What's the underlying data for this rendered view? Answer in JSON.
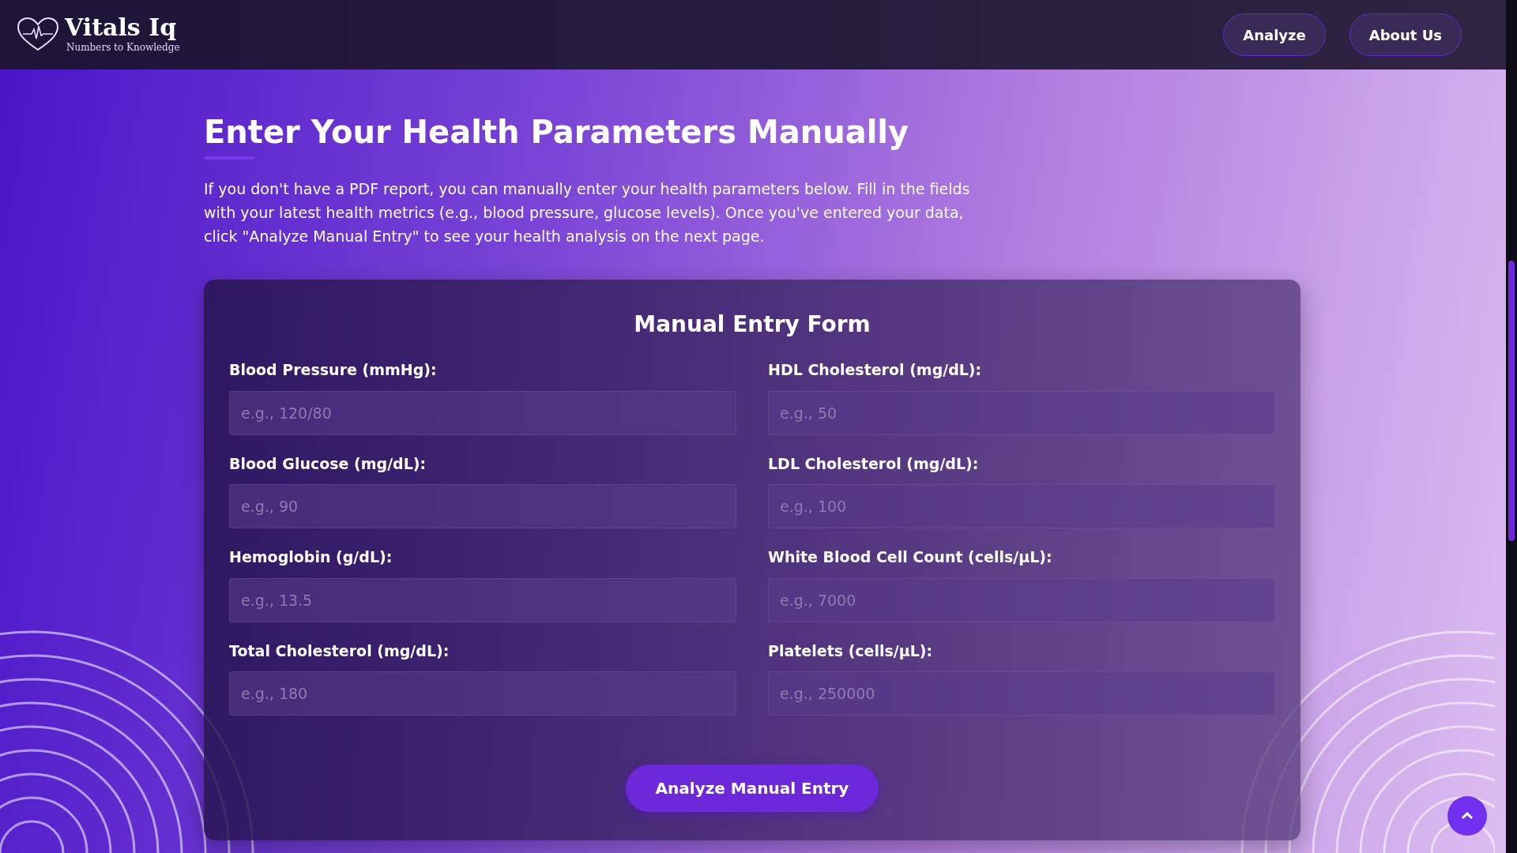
{
  "header": {
    "brand": "Vitals Iq",
    "tagline": "Numbers to Knowledge",
    "nav": [
      "Analyze",
      "About Us"
    ]
  },
  "intro": {
    "title": "Enter Your Health Parameters Manually",
    "text": "If you don't have a PDF report, you can manually enter your health parameters below. Fill in the fields with your latest health metrics (e.g., blood pressure, glucose levels). Once you've entered your data, click \"Analyze Manual Entry\" to see your health analysis on the next page."
  },
  "form": {
    "title": "Manual Entry Form",
    "fields": [
      {
        "label": "Blood Pressure (mmHg):",
        "placeholder": "e.g., 120/80"
      },
      {
        "label": "HDL Cholesterol (mg/dL):",
        "placeholder": "e.g., 50"
      },
      {
        "label": "Blood Glucose (mg/dL):",
        "placeholder": "e.g., 90"
      },
      {
        "label": "LDL Cholesterol (mg/dL):",
        "placeholder": "e.g., 100"
      },
      {
        "label": "Hemoglobin (g/dL):",
        "placeholder": "e.g., 13.5"
      },
      {
        "label": "White Blood Cell Count (cells/µL):",
        "placeholder": "e.g., 7000"
      },
      {
        "label": "Total Cholesterol (mg/dL):",
        "placeholder": "e.g., 180"
      },
      {
        "label": "Platelets (cells/µL):",
        "placeholder": "e.g., 250000"
      }
    ],
    "submit": "Analyze Manual Entry"
  }
}
